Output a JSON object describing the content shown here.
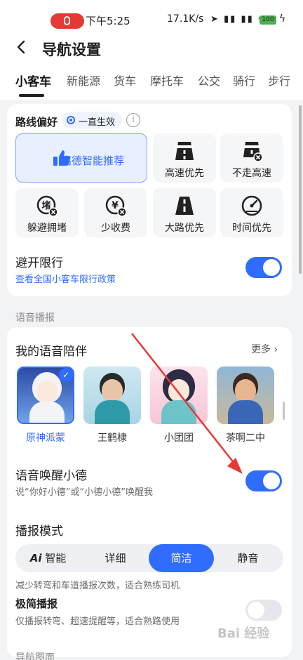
{
  "status": {
    "time": "下午5:25",
    "speed": "17.1K/s",
    "battery": "100"
  },
  "header": {
    "title": "导航设置"
  },
  "tabs": [
    "小客车",
    "新能源",
    "货车",
    "摩托车",
    "公交",
    "骑行",
    "步行"
  ],
  "route": {
    "label": "路线偏好",
    "chip": "一直生效",
    "options": [
      "高德智能推荐",
      "高速优先",
      "不走高速",
      "躲避拥堵",
      "少收费",
      "大路优先",
      "时间优先"
    ]
  },
  "restriction": {
    "title": "避开限行",
    "link": "查看全国小客车限行政策",
    "on": true
  },
  "voice": {
    "section": "语音播报",
    "companion_title": "我的语音陪伴",
    "more": "更多",
    "avatars": [
      "原神派蒙",
      "王鹤棣",
      "小团团",
      "茶啊二中"
    ],
    "wake_title": "语音唤醒小德",
    "wake_sub": "说“你好小德”或“小德小德”唤醒我",
    "wake_on": true,
    "mode_title": "播报模式",
    "modes": [
      "智能",
      "详细",
      "简洁",
      "静音"
    ],
    "mode_ai": "Ai",
    "active_mode": "简洁",
    "mode_desc": "减少转弯和车道播报次数，适合熟练司机",
    "minimal_title": "极简播报",
    "minimal_sub": "仅播报转弯、超速提醒等，适合熟路使用",
    "minimal_on": false
  },
  "next_section": "导航图面",
  "watermark": "Bai 经验"
}
